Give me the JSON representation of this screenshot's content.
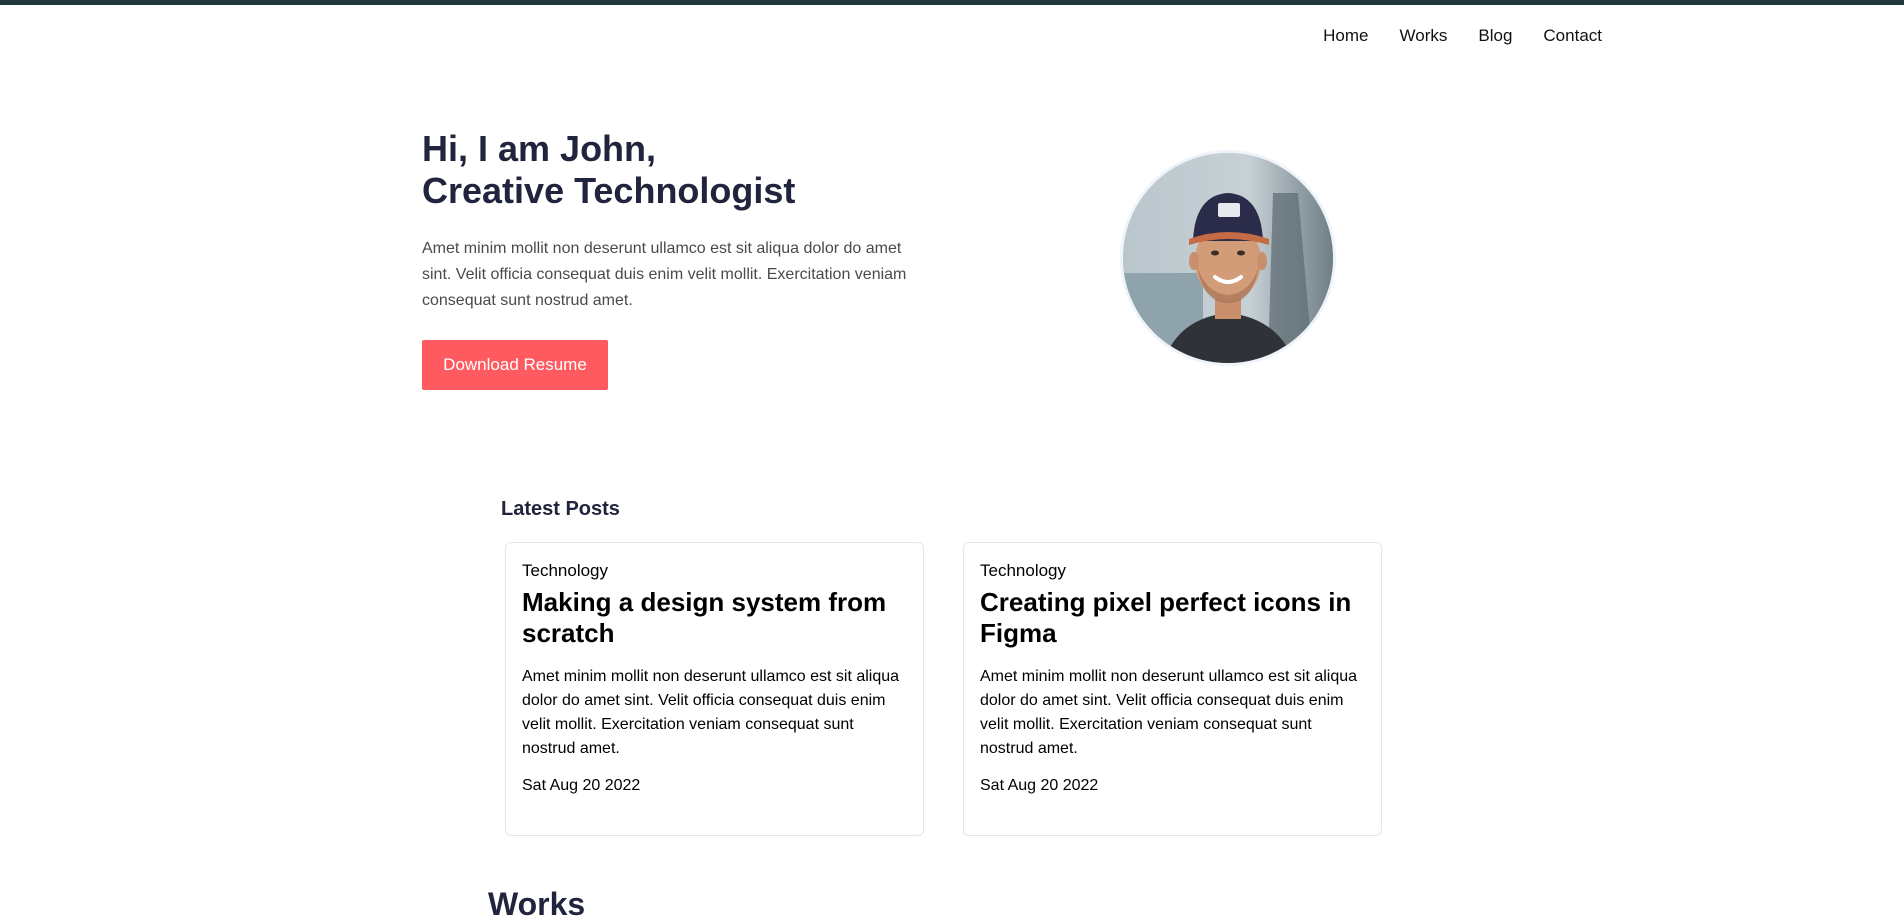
{
  "nav": {
    "items": [
      "Home",
      "Works",
      "Blog",
      "Contact"
    ]
  },
  "hero": {
    "title_line1": "Hi, I am John,",
    "title_line2": "Creative Technologist",
    "description": "Amet minim mollit non deserunt ullamco est sit aliqua dolor do amet sint. Velit officia consequat duis enim velit mollit. Exercitation veniam consequat sunt nostrud amet.",
    "button_label": "Download Resume",
    "avatar_icon": "profile-photo"
  },
  "posts": {
    "heading": "Latest Posts",
    "items": [
      {
        "category": "Technology",
        "title": "Making a design system from scratch",
        "excerpt": "Amet minim mollit non deserunt ullamco est sit aliqua dolor do amet sint. Velit officia consequat duis enim velit mollit. Exercitation veniam consequat sunt nostrud amet.",
        "date": "Sat Aug 20 2022"
      },
      {
        "category": "Technology",
        "title": "Creating pixel perfect icons in Figma",
        "excerpt": "Amet minim mollit non deserunt ullamco est sit aliqua dolor do amet sint. Velit officia consequat duis enim velit mollit. Exercitation veniam consequat sunt nostrud amet.",
        "date": "Sat Aug 20 2022"
      }
    ]
  },
  "works": {
    "heading": "Works"
  },
  "colors": {
    "accent": "#ff5a5f",
    "topbar": "#21383d",
    "text": "#21243d"
  }
}
